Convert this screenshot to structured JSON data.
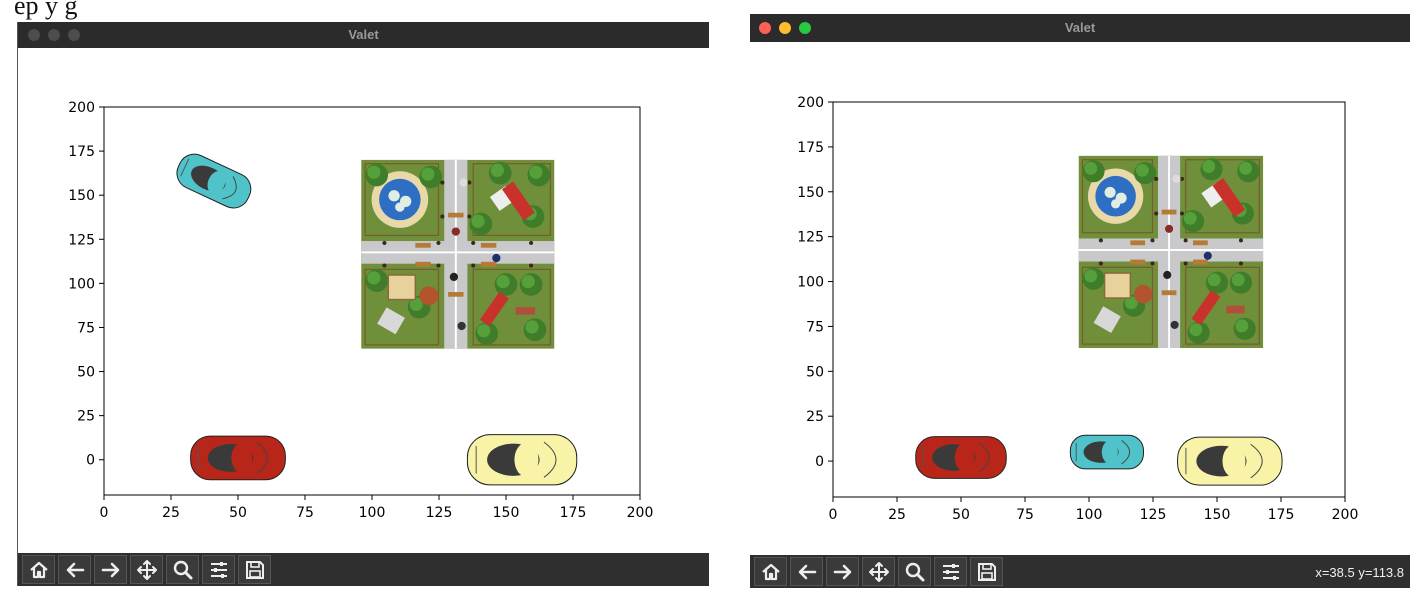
{
  "intro_text": "ep                 y    g",
  "windows": [
    {
      "id": "left",
      "title": "Valet",
      "traffic_lights": "inactive",
      "coords_text": ""
    },
    {
      "id": "right",
      "title": "Valet",
      "traffic_lights": "active",
      "coords_text": "x=38.5 y=113.8"
    }
  ],
  "toolbar": {
    "buttons": [
      "home-icon",
      "back-arrow-icon",
      "forward-arrow-icon",
      "pan-icon",
      "zoom-icon",
      "configure-subplots-icon",
      "save-icon"
    ]
  },
  "colors": {
    "titlebar": "#2b2b2b",
    "toolbar": "#2f2f2f",
    "close": "#ff5f57",
    "minimize": "#febc2e",
    "zoom": "#28c840",
    "inactive_light": "#4d4d4d"
  },
  "chart_data": [
    {
      "type": "scatter",
      "xlim": [
        0,
        200
      ],
      "ylim": [
        -20,
        200
      ],
      "xticks": [
        0,
        25,
        50,
        75,
        100,
        125,
        150,
        175,
        200
      ],
      "yticks": [
        0,
        25,
        50,
        75,
        100,
        125,
        150,
        175,
        200
      ],
      "park": {
        "x": [
          96,
          168
        ],
        "y": [
          63,
          170
        ]
      },
      "cars": [
        {
          "name": "cyan-car",
          "color": "#4fc3c9",
          "x": 41,
          "y": 158,
          "angle": 25
        },
        {
          "name": "red-car",
          "color": "#b8261a",
          "x": 50,
          "y": 1,
          "angle": 0
        },
        {
          "name": "yellow-car",
          "color": "#f8f3a6",
          "x": 156,
          "y": 0,
          "angle": 0
        }
      ]
    },
    {
      "type": "scatter",
      "xlim": [
        0,
        200
      ],
      "ylim": [
        -20,
        200
      ],
      "xticks": [
        0,
        25,
        50,
        75,
        100,
        125,
        150,
        175,
        200
      ],
      "yticks": [
        0,
        25,
        50,
        75,
        100,
        125,
        150,
        175,
        200
      ],
      "park": {
        "x": [
          96,
          168
        ],
        "y": [
          63,
          170
        ]
      },
      "cars": [
        {
          "name": "cyan-car",
          "color": "#4fc3c9",
          "x": 107,
          "y": 5,
          "angle": 0
        },
        {
          "name": "red-car",
          "color": "#b8261a",
          "x": 50,
          "y": 2,
          "angle": 0
        },
        {
          "name": "yellow-car",
          "color": "#f8f3a6",
          "x": 155,
          "y": 0,
          "angle": 0
        }
      ]
    }
  ]
}
